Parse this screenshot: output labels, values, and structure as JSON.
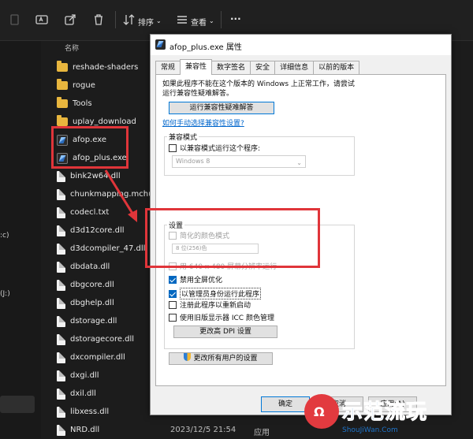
{
  "toolbar": {
    "sort_label": "排序",
    "view_label": "查看",
    "more_label": "···"
  },
  "nav": {
    "drive_c_fragment": ":c)",
    "drive_j_fragment": "(J:)"
  },
  "file_list": {
    "column_name": "名称",
    "items": [
      {
        "name": "reshade-shaders",
        "type": "folder"
      },
      {
        "name": "rogue",
        "type": "folder"
      },
      {
        "name": "Tools",
        "type": "folder"
      },
      {
        "name": "uplay_download",
        "type": "folder"
      },
      {
        "name": "afop.exe",
        "type": "exe"
      },
      {
        "name": "afop_plus.exe",
        "type": "exe"
      },
      {
        "name": "bink2w64.dll",
        "type": "doc"
      },
      {
        "name": "chunkmapping.mchunk",
        "type": "doc"
      },
      {
        "name": "codecl.txt",
        "type": "doc"
      },
      {
        "name": "d3d12core.dll",
        "type": "doc"
      },
      {
        "name": "d3dcompiler_47.dll",
        "type": "doc"
      },
      {
        "name": "dbdata.dll",
        "type": "doc"
      },
      {
        "name": "dbgcore.dll",
        "type": "doc"
      },
      {
        "name": "dbghelp.dll",
        "type": "doc"
      },
      {
        "name": "dstorage.dll",
        "type": "doc"
      },
      {
        "name": "dstoragecore.dll",
        "type": "doc"
      },
      {
        "name": "dxcompiler.dll",
        "type": "doc"
      },
      {
        "name": "dxgi.dll",
        "type": "doc"
      },
      {
        "name": "dxil.dll",
        "type": "doc"
      },
      {
        "name": "libxess.dll",
        "type": "doc"
      },
      {
        "name": "NRD.dll",
        "type": "doc"
      }
    ],
    "last_row_date": "2023/12/5 21:54",
    "last_row_type": "应用"
  },
  "dialog": {
    "title": "afop_plus.exe 属性",
    "tabs": [
      "常规",
      "兼容性",
      "数字签名",
      "安全",
      "详细信息",
      "以前的版本"
    ],
    "active_tab": 1,
    "intro_text": "如果此程序不能在这个版本的 Windows 上正常工作，请尝试运行兼容性疑难解答。",
    "troubleshooter_button": "运行兼容性疑难解答",
    "manual_link": "如何手动选择兼容性设置?",
    "compat_mode": {
      "group_label": "兼容模式",
      "checkbox_label": "以兼容模式运行这个程序:",
      "checked": false,
      "select_value": "Windows 8"
    },
    "settings": {
      "group_label": "设置",
      "reduced_color": {
        "label": "简化的颜色模式",
        "checked": false
      },
      "color_select_value": "8 位(256)色",
      "res_640": {
        "label": "用 640 x 480 屏幕分辨率运行",
        "checked": false
      },
      "disable_fullscreen": {
        "label": "禁用全屏优化",
        "checked": true
      },
      "run_as_admin": {
        "label": "以管理员身份运行此程序",
        "checked": true
      },
      "register_restart": {
        "label": "注册此程序以重新启动",
        "checked": false
      },
      "legacy_icc": {
        "label": "使用旧版显示器 ICC 颜色管理",
        "checked": false
      },
      "dpi_button": "更改高 DPI 设置"
    },
    "all_users_button": "更改所有用户的设置",
    "ok_button": "确定",
    "cancel_button": "取消",
    "apply_button": "应用(A)"
  },
  "watermark": {
    "brand": "示范流玩",
    "url": "ShouJiWan.Com",
    "logo_char": "Ω"
  },
  "colors": {
    "annotation_red": "#e0353a",
    "checkbox_blue": "#0067c0",
    "link_blue": "#0066cc",
    "folder_yellow": "#e8b63e"
  }
}
